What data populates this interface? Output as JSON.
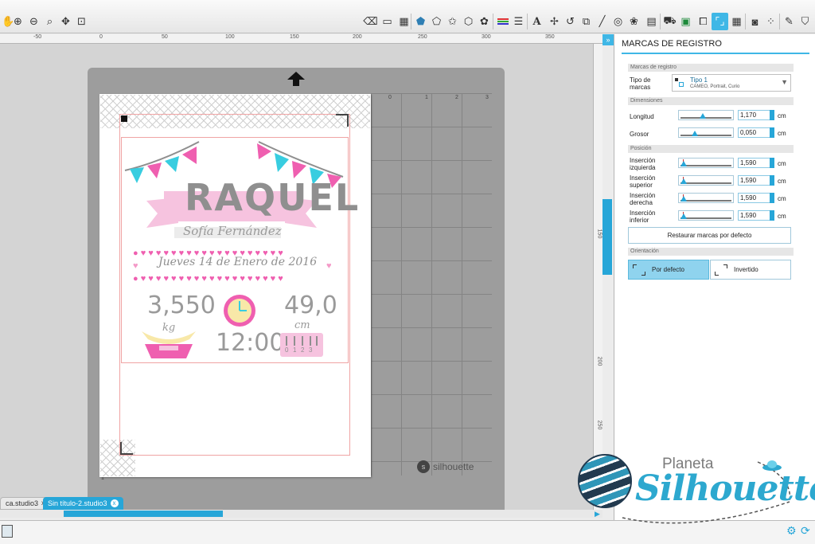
{
  "toolbar": {
    "left_tools": [
      "hand-icon",
      "zoom-in-icon",
      "zoom-out-icon",
      "zoom-box-icon",
      "pan-icon",
      "fit-page-icon"
    ],
    "right_tools": [
      "eraser-icon",
      "page-settings-icon",
      "grid-settings-icon",
      "pentagon-fill-icon",
      "polygon-icon",
      "star-icon",
      "shape-icon",
      "replicate-icon",
      "line-color-icon",
      "line-style-icon",
      "text-icon",
      "transform-icon",
      "rotate-icon",
      "scale-icon",
      "knife-icon",
      "offset-icon",
      "trace-icon",
      "library-icon",
      "send-icon",
      "store-icon",
      "registration-icon",
      "grid-icon",
      "fill-pattern-icon",
      "nesting-icon",
      "sketch-icon",
      "cut-settings-icon"
    ]
  },
  "rulers": {
    "horizontal_labels": [
      "-50",
      "0",
      "50",
      "100",
      "150",
      "200",
      "250",
      "300",
      "350"
    ],
    "vertical_labels": [
      "150",
      "200",
      "250"
    ],
    "mat_top_labels": [
      "0",
      "1",
      "2",
      "3"
    ],
    "mat_side_labels": [
      "1",
      "2"
    ]
  },
  "mat": {
    "brand": "silhouette",
    "logo_letter": "s"
  },
  "design": {
    "name": "RAQUEL",
    "subtitle_script": "Sofía Fernández",
    "date": "Jueves 14 de Enero de 2016",
    "weight_value": "3,550",
    "weight_unit": "kg",
    "time": "12:00",
    "height_value": "49,0",
    "height_unit": "cm",
    "ruler_numbers": [
      "0",
      "1",
      "2",
      "3"
    ],
    "colors": {
      "pink": "#f49ac8",
      "hot_pink": "#ef5fb0",
      "cyan": "#38cde0",
      "gray": "#8f8f8f",
      "light_pink": "#f6c3df",
      "clock_yellow": "#f8e8a8"
    }
  },
  "doc_tabs": [
    {
      "label": "ca.studio3",
      "close": "x",
      "active": false
    },
    {
      "label": "Sin título-2.studio3",
      "close": "x",
      "active": true
    }
  ],
  "panel": {
    "title": "MARCAS DE REGISTRO",
    "collapse_glyph": "»",
    "section_registration": "Marcas de registro",
    "type_label": "Tipo de marcas",
    "type_value": "Tipo 1",
    "type_sub": "CAMEO, Portrait, Curio",
    "dropdown_arrow": "▼",
    "section_dimensions": "Dimensiones",
    "length_label": "Longitud",
    "length_value": "1,170",
    "thickness_label": "Grosor",
    "thickness_value": "0,050",
    "section_position": "Posición",
    "inset_left_label": "Inserción izquierda",
    "inset_left_value": "1,590",
    "inset_top_label": "Inserción superior",
    "inset_top_value": "1,590",
    "inset_right_label": "Inserción derecha",
    "inset_right_value": "1,590",
    "inset_bottom_label": "Inserción inferior",
    "inset_bottom_value": "1,590",
    "unit": "cm",
    "reset_button": "Restaurar marcas por defecto",
    "section_orientation": "Orientación",
    "orient_default": "Por defecto",
    "orient_inverted": "Invertido",
    "accent": "#3fb7e6"
  },
  "watermark": {
    "line1": "Planeta",
    "line2": "Silhouette"
  }
}
